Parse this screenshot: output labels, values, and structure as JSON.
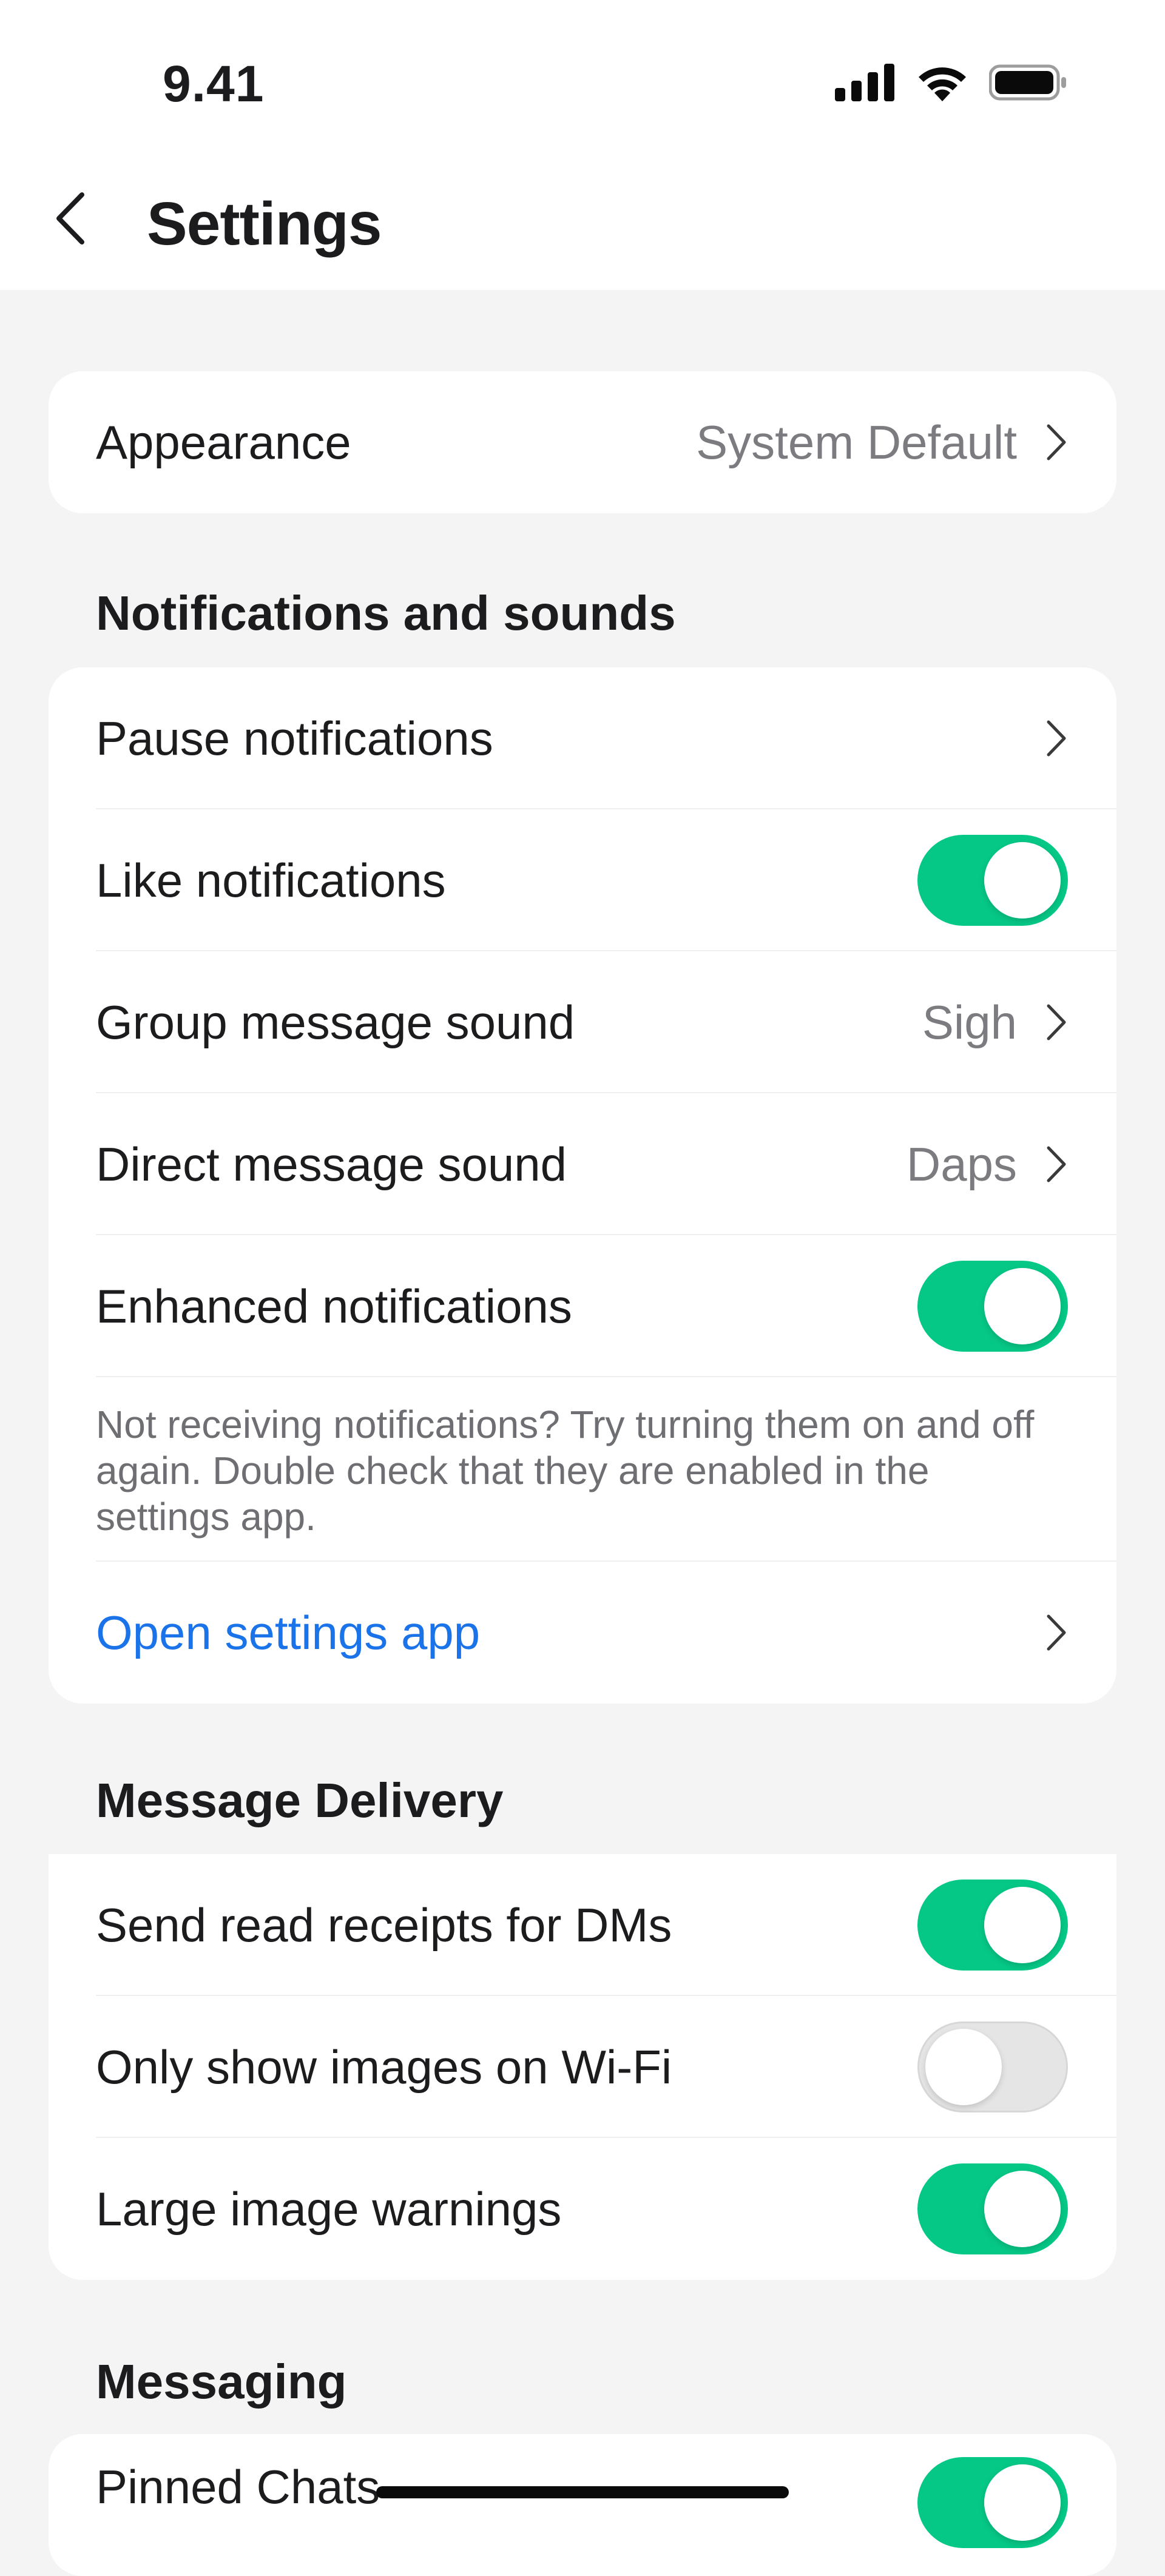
{
  "status_bar": {
    "time": "9.41"
  },
  "header": {
    "title": "Settings"
  },
  "appearance": {
    "label": "Appearance",
    "value": "System Default"
  },
  "notifications": {
    "section_title": "Notifications and sounds",
    "pause_label": "Pause notifications",
    "like_label": "Like notifications",
    "like_enabled": true,
    "group_sound_label": "Group message sound",
    "group_sound_value": "Sigh",
    "direct_sound_label": "Direct message sound",
    "direct_sound_value": "Daps",
    "enhanced_label": "Enhanced notifications",
    "enhanced_enabled": true,
    "footnote": "Not receiving notifications? Try turning them on and off again. Double check that they are enabled in the settings app.",
    "open_settings_label": "Open settings app"
  },
  "delivery": {
    "section_title": "Message Delivery",
    "read_receipts_label": "Send read receipts for DMs",
    "read_receipts_enabled": true,
    "wifi_images_label": "Only show images on Wi-Fi",
    "wifi_images_enabled": false,
    "large_image_label": "Large image warnings",
    "large_image_enabled": true
  },
  "messaging": {
    "section_title": "Messaging",
    "pinned_chats_label": "Pinned Chats",
    "pinned_chats_enabled": true
  },
  "colors": {
    "toggle_on": "#06c886",
    "toggle_off": "#e5e5e5",
    "link": "#1a73e8",
    "background": "#f4f4f4"
  }
}
